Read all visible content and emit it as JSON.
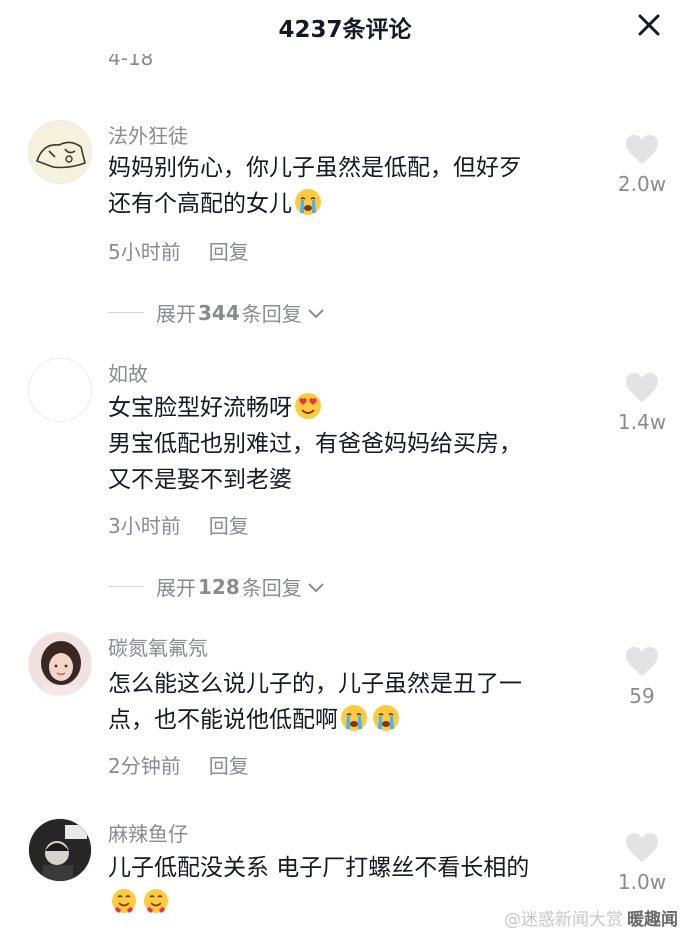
{
  "header": {
    "title": "4237条评论"
  },
  "partial_above": "4-18",
  "comments": [
    {
      "username": "法外狂徒",
      "text_lines": [
        "妈妈别伤心，你儿子虽然是低配，但好歹",
        "还有个高配的女儿"
      ],
      "time": "5小时前",
      "reply_label": "回复",
      "likes": "2.0w",
      "expand": {
        "prefix": "展开",
        "count": "344",
        "suffix": "条回复"
      }
    },
    {
      "username": "如故",
      "text_lines": [
        "女宝脸型好流畅呀",
        "男宝低配也别难过，有爸爸妈妈给买房，",
        "又不是娶不到老婆"
      ],
      "time": "3小时前",
      "reply_label": "回复",
      "likes": "1.4w",
      "expand": {
        "prefix": "展开",
        "count": "128",
        "suffix": "条回复"
      }
    },
    {
      "username": "碳氮氧氟氖",
      "text_lines": [
        "怎么能这么说儿子的，儿子虽然是丑了一",
        "点，也不能说他低配啊"
      ],
      "time": "2分钟前",
      "reply_label": "回复",
      "likes": "59"
    },
    {
      "username": "麻辣鱼仔",
      "text_lines": [
        "儿子低配没关系 电子厂打螺丝不看长相的"
      ],
      "likes": "1.0w"
    }
  ],
  "watermark": {
    "left": "@迷惑新闻大赏",
    "brand": "暖趣闻"
  },
  "icons": {
    "close": "close-icon",
    "like": "heart-icon",
    "expand": "chevron-down-icon",
    "crying": "loudly-crying-emoji",
    "heart_eyes": "heart-eyes-emoji",
    "hugging": "hugging-emoji"
  },
  "colors": {
    "text": "#161823",
    "secondary": "#8a8b91",
    "heart": "#e6e6e8"
  }
}
